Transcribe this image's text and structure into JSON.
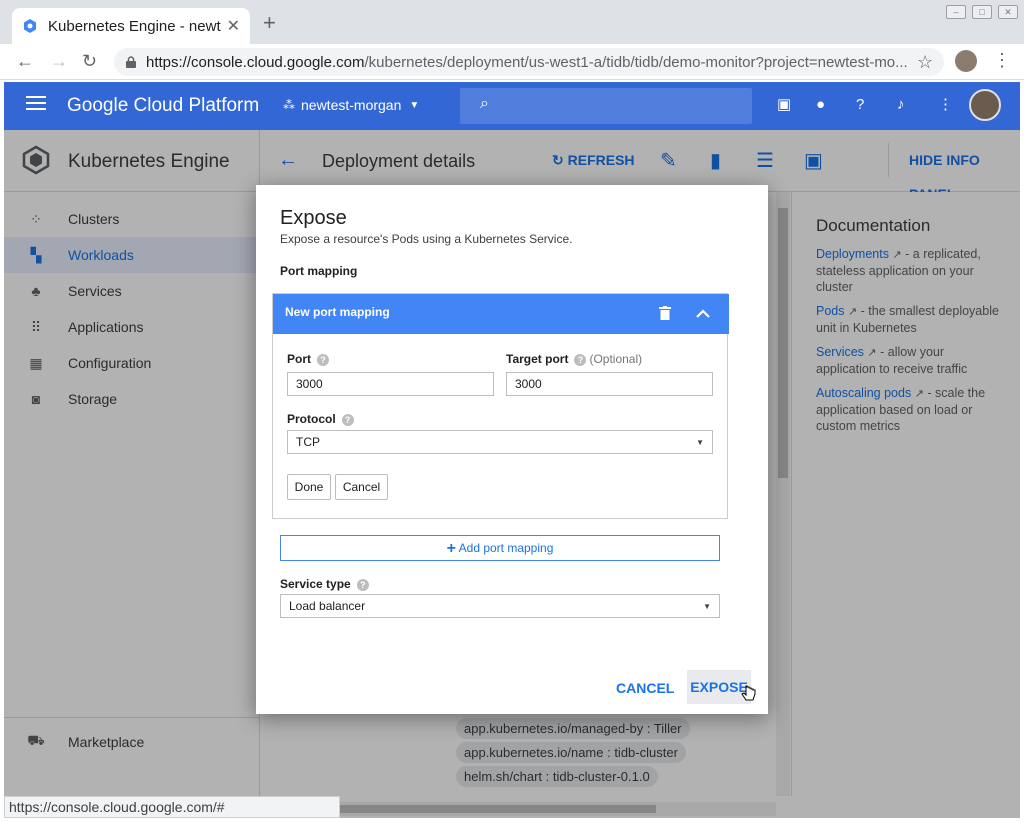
{
  "browser": {
    "tab_title": "Kubernetes Engine - newt",
    "new_tab": "+",
    "url_host": "https://console.cloud.google.com",
    "url_path": "/kubernetes/deployment/us-west1-a/tidb/tidb/demo-monitor?project=newtest-mo..."
  },
  "gcp": {
    "platform_title": "Google Cloud Platform",
    "project": "newtest-morgan"
  },
  "sidebar": {
    "title": "Kubernetes Engine",
    "items": [
      {
        "label": "Clusters",
        "icon": "clusters-icon"
      },
      {
        "label": "Workloads",
        "icon": "workloads-icon"
      },
      {
        "label": "Services",
        "icon": "services-icon"
      },
      {
        "label": "Applications",
        "icon": "applications-icon"
      },
      {
        "label": "Configuration",
        "icon": "configuration-icon"
      },
      {
        "label": "Storage",
        "icon": "storage-icon"
      }
    ],
    "footer": "Marketplace"
  },
  "page": {
    "title": "Deployment details",
    "refresh": "REFRESH",
    "hide_info": "HIDE INFO PANEL"
  },
  "labels": [
    "app.kubernetes.io/managed-by : Tiller",
    "app.kubernetes.io/name : tidb-cluster",
    "helm.sh/chart : tidb-cluster-0.1.0"
  ],
  "info_panel": {
    "title": "Documentation",
    "items": [
      {
        "link": "Deployments",
        "text": " - a replicated, stateless application on your cluster"
      },
      {
        "link": "Pods",
        "text": " - the smallest deployable unit in Kubernetes"
      },
      {
        "link": "Services",
        "text": " - allow your application to receive traffic"
      },
      {
        "link": "Autoscaling pods",
        "text": " - scale the application based on load or custom metrics"
      }
    ]
  },
  "status_url": "https://console.cloud.google.com/#",
  "dialog": {
    "title": "Expose",
    "subtitle": "Expose a resource's Pods using a Kubernetes Service.",
    "port_mapping_label": "Port mapping",
    "new_port_mapping": "New port mapping",
    "port_label": "Port",
    "port_value": "3000",
    "target_port_label": "Target port",
    "target_optional": "(Optional)",
    "target_port_value": "3000",
    "protocol_label": "Protocol",
    "protocol_value": "TCP",
    "done": "Done",
    "cancel_small": "Cancel",
    "add_port_mapping": "Add port mapping",
    "service_type_label": "Service type",
    "service_type_value": "Load balancer",
    "cancel": "CANCEL",
    "expose": "EXPOSE"
  },
  "colors": {
    "header_blue": "#3367d6",
    "accent_blue": "#1a73e8",
    "card_blue": "#4285f4"
  }
}
